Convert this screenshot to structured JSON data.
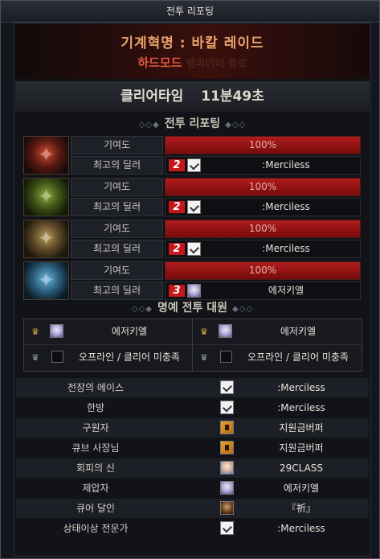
{
  "window": {
    "title": "전투 리포팅"
  },
  "raid": {
    "title": "기계혁명 : 바칼 레이드",
    "mode": "하드모드",
    "mode_suffix": "뱀파이어 플로"
  },
  "clear": {
    "label": "클리어타임",
    "time": "11분49초"
  },
  "report_section": {
    "title": "전투 리포팅"
  },
  "reports": [
    {
      "contribution_label": "기여도",
      "contribution_value": "100%",
      "contribution_fraction": 1.0,
      "dealer_label": "최고의 딜러",
      "rank": "2",
      "player": ":Merciless",
      "player_icon": "white-flag-icon"
    },
    {
      "contribution_label": "기여도",
      "contribution_value": "100%",
      "contribution_fraction": 1.0,
      "dealer_label": "최고의 딜러",
      "rank": "2",
      "player": ":Merciless",
      "player_icon": "white-flag-icon"
    },
    {
      "contribution_label": "기여도",
      "contribution_value": "100%",
      "contribution_fraction": 1.0,
      "dealer_label": "최고의 딜러",
      "rank": "2",
      "player": ":Merciless",
      "player_icon": "white-flag-icon"
    },
    {
      "contribution_label": "기여도",
      "contribution_value": "100%",
      "contribution_fraction": 1.0,
      "dealer_label": "최고의 딜러",
      "rank": "3",
      "player": "에저키엘",
      "player_icon": "character-avatar-icon"
    }
  ],
  "honor_section": {
    "title": "명예 전투 대원"
  },
  "honor": {
    "top_left": "에저키엘",
    "top_right": "에저키엘",
    "bottom_left": "오프라인 / 클리어 미충족",
    "bottom_right": "오프라인 / 클리어 미충족"
  },
  "awards": [
    {
      "title": "전장의 에이스",
      "player": ":Merciless",
      "icon": "white-flag-icon"
    },
    {
      "title": "한방",
      "player": ":Merciless",
      "icon": "white-flag-icon"
    },
    {
      "title": "구원자",
      "player": "지원금버퍼",
      "icon": "pixel-character-icon"
    },
    {
      "title": "큐브 사장님",
      "player": "지원금버퍼",
      "icon": "pixel-character-icon"
    },
    {
      "title": "회피의 신",
      "player": "29CLASS",
      "icon": "character-avatar-icon"
    },
    {
      "title": "제압자",
      "player": "에저키엘",
      "icon": "character-avatar-icon"
    },
    {
      "title": "큐어 달인",
      "player": "『祈』",
      "icon": "character-avatar-icon"
    },
    {
      "title": "상태이상 전문가",
      "player": ":Merciless",
      "icon": "white-flag-icon"
    }
  ]
}
